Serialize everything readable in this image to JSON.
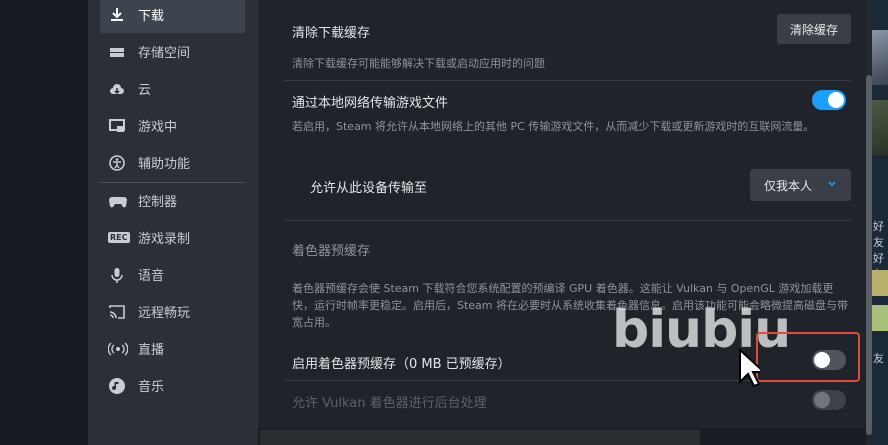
{
  "sidebar": {
    "items": [
      {
        "label": "下载",
        "icon": "download-icon",
        "active": true
      },
      {
        "label": "存储空间",
        "icon": "storage-icon",
        "active": false
      },
      {
        "label": "云",
        "icon": "cloud-icon",
        "active": false
      },
      {
        "label": "游戏中",
        "icon": "in-game-icon",
        "active": false
      },
      {
        "label": "辅助功能",
        "icon": "accessibility-icon",
        "active": false
      },
      {
        "label": "控制器",
        "icon": "controller-icon",
        "active": false
      },
      {
        "label": "游戏录制",
        "icon": "rec-icon",
        "active": false
      },
      {
        "label": "语音",
        "icon": "microphone-icon",
        "active": false
      },
      {
        "label": "远程畅玩",
        "icon": "remote-play-icon",
        "active": false
      },
      {
        "label": "直播",
        "icon": "broadcast-icon",
        "active": false
      },
      {
        "label": "音乐",
        "icon": "music-icon",
        "active": false
      }
    ],
    "rec_badge": "REC"
  },
  "settings": {
    "clear_cache": {
      "title": "清除下载缓存",
      "button": "清除缓存",
      "desc": "清除下载缓存可能能够解决下载或启动应用时的问题"
    },
    "lan_transfer": {
      "title": "通过本地网络传输游戏文件",
      "enabled": true,
      "desc": "若启用，Steam 将允许从本地网络上的其他 PC 传输游戏文件，从而减少下载或更新游戏时的互联网流量。"
    },
    "allow_transfer": {
      "title": "允许从此设备传输至",
      "selected": "仅我本人"
    },
    "shader_section": {
      "heading": "着色器预缓存",
      "desc": "着色器预缓存会使 Steam 下载符合您系统配置的预编译 GPU 着色器。这能让 Vulkan 与 OpenGL 游戏加载更快，运行时帧率更稳定。启用后，Steam 将在必要时从系统收集着色器信息。启用该功能可能会略微提高磁盘与带宽占用。"
    },
    "shader_precache": {
      "title": "启用着色器预缓存（0 MB 已预缓存）",
      "enabled": false
    },
    "vulkan_bg": {
      "title": "允许 Vulkan 着色器进行后台处理",
      "enabled": false
    }
  },
  "right_panel": {
    "snippets": [
      "好友",
      "好友",
      "友"
    ]
  },
  "watermark": "biubiu",
  "colors": {
    "accent": "#1a9fff",
    "highlight": "#e04b3a",
    "active_item": "#3d4450"
  }
}
